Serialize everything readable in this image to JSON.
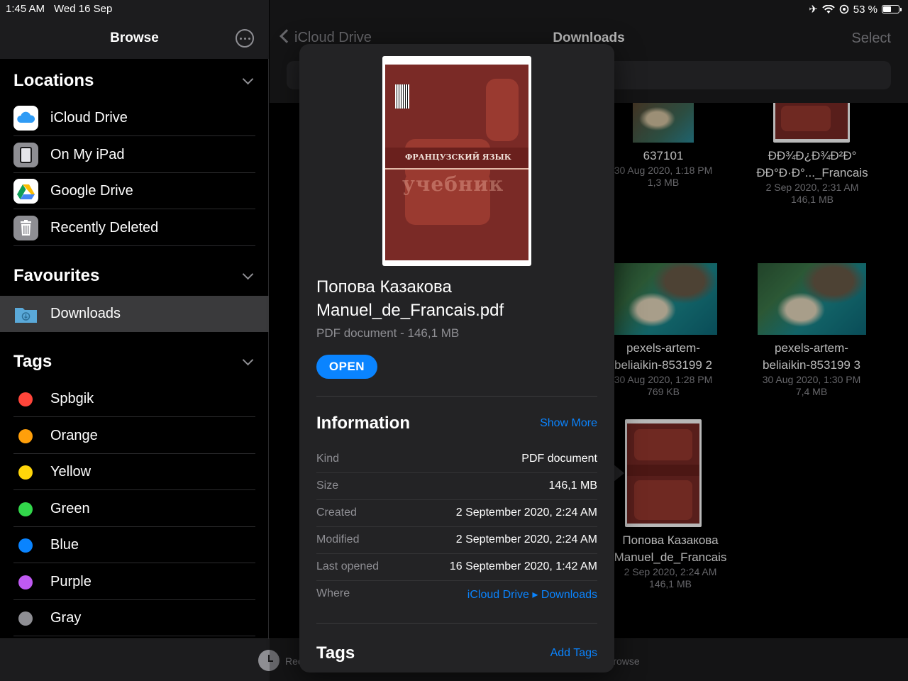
{
  "status": {
    "time": "1:45 AM",
    "date": "Wed 16 Sep",
    "battery": "53 %",
    "battery_level": 0.53
  },
  "sidebar": {
    "title": "Browse",
    "locations_header": "Locations",
    "locations": [
      {
        "label": "iCloud Drive",
        "icon": "icloud-icon"
      },
      {
        "label": "On My iPad",
        "icon": "ipad-icon"
      },
      {
        "label": "Google Drive",
        "icon": "google-drive-icon"
      },
      {
        "label": "Recently Deleted",
        "icon": "trash-icon"
      }
    ],
    "favourites_header": "Favourites",
    "favourites": [
      {
        "label": "Downloads",
        "icon": "folder-download-icon"
      }
    ],
    "tags_header": "Tags",
    "tags": [
      {
        "label": "Spbgik",
        "color": "#ff453a"
      },
      {
        "label": "Orange",
        "color": "#ff9f0a"
      },
      {
        "label": "Yellow",
        "color": "#ffd60a"
      },
      {
        "label": "Green",
        "color": "#32d74b"
      },
      {
        "label": "Blue",
        "color": "#0a84ff"
      },
      {
        "label": "Purple",
        "color": "#bf5af2"
      },
      {
        "label": "Gray",
        "color": "#8e8e93"
      }
    ]
  },
  "main": {
    "back_label": "iCloud Drive",
    "title": "Downloads",
    "select_label": "Select",
    "files": [
      {
        "name_lines": [
          "637101"
        ],
        "date": "30 Aug 2020, 1:18 PM",
        "size": "1,3 MB"
      },
      {
        "name_lines": [
          "ÐÐ¾Ð¿Ð¾Ð²Ð°",
          "ÐÐ°Ð·Ð°..._Francais"
        ],
        "date": "2 Sep 2020, 2:31 AM",
        "size": "146,1 MB"
      },
      {
        "name_lines": [
          "pexels-artem-",
          "beliaikin-853199 2"
        ],
        "date": "30 Aug 2020, 1:28 PM",
        "size": "769 KB"
      },
      {
        "name_lines": [
          "pexels-artem-",
          "beliaikin-853199 3"
        ],
        "date": "30 Aug 2020, 1:30 PM",
        "size": "7,4 MB"
      },
      {
        "name_lines": [
          "Попова Казакова",
          "Manuel_de_Francais"
        ],
        "date": "2 Sep 2020, 2:24 AM",
        "size": "146,1 MB"
      }
    ]
  },
  "tabbar": {
    "recents": "Recents",
    "browse": "Browse"
  },
  "popover": {
    "title": "Попова Казакова Manuel_de_Francais.pdf",
    "subtitle": "PDF document - 146,1 MB",
    "open_label": "OPEN",
    "info_header": "Information",
    "show_more": "Show More",
    "info": [
      {
        "key": "Kind",
        "value": "PDF document"
      },
      {
        "key": "Size",
        "value": "146,1 MB"
      },
      {
        "key": "Created",
        "value": "2 September 2020, 2:24 AM"
      },
      {
        "key": "Modified",
        "value": "2 September 2020, 2:24 AM"
      },
      {
        "key": "Last opened",
        "value": "16 September 2020, 1:42 AM"
      },
      {
        "key": "Where",
        "value": "iCloud Drive ▸ Downloads"
      }
    ],
    "tags_header": "Tags",
    "add_tags": "Add Tags",
    "book_word": "учебник",
    "book_subject": "ФРАНЦУЗСКИЙ ЯЗЫК"
  }
}
